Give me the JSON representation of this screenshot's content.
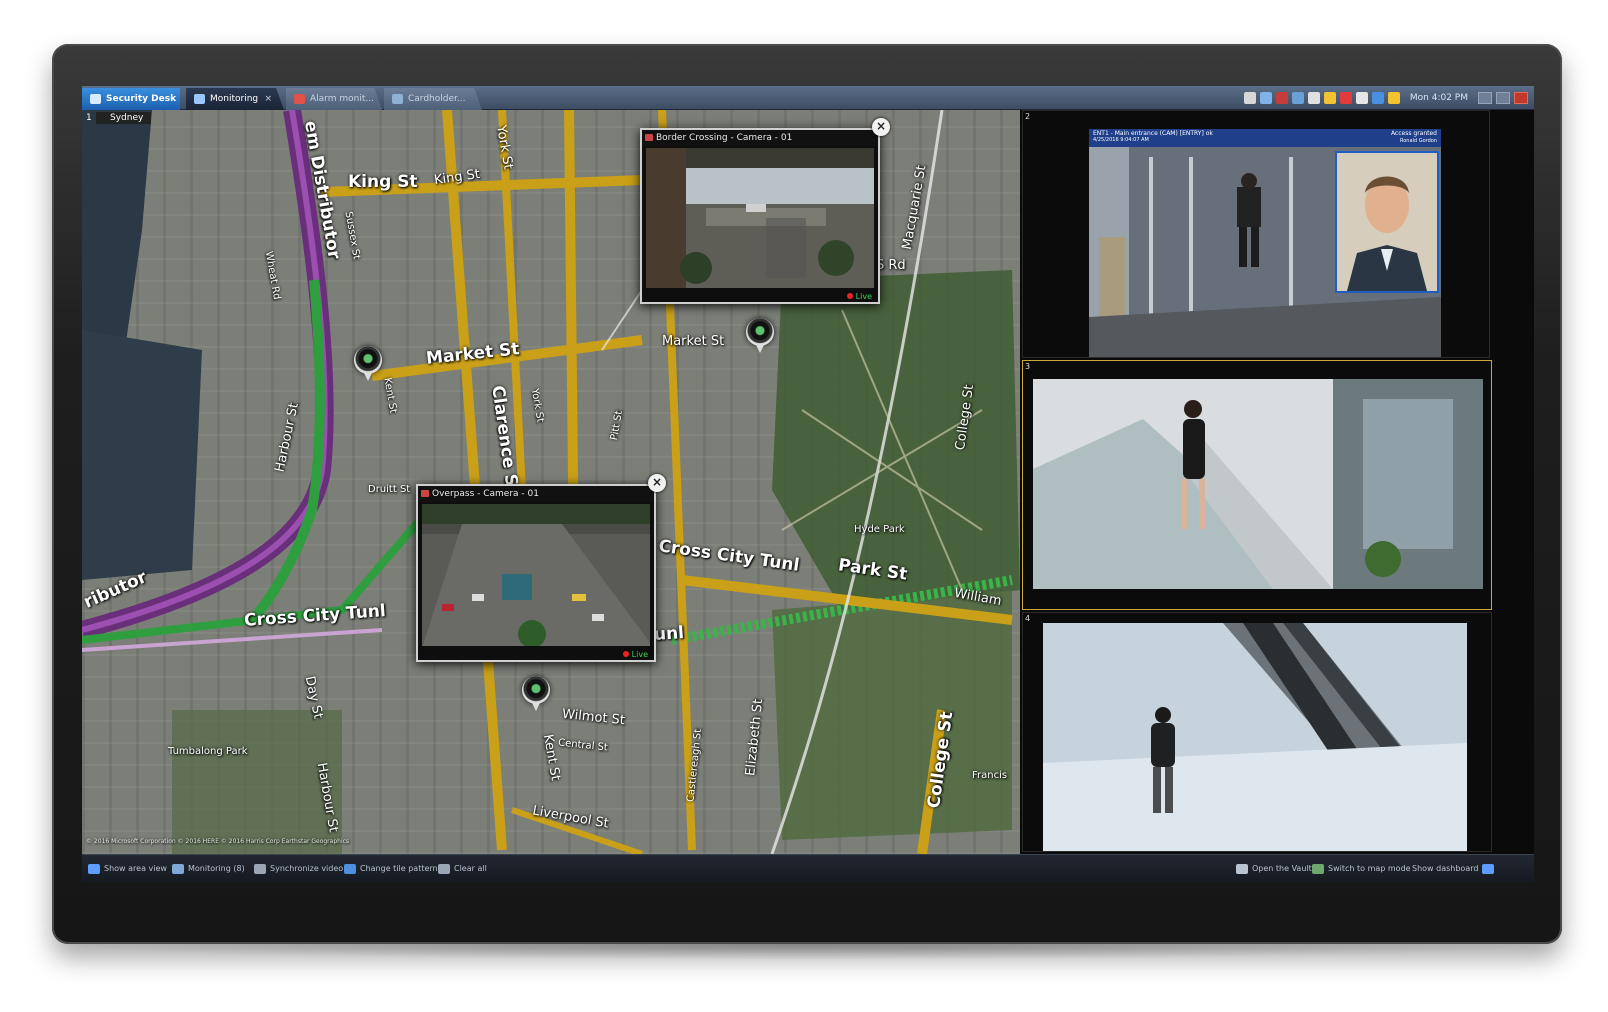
{
  "tabs": [
    {
      "label": "Security Desk",
      "icon": "security-desk-icon"
    },
    {
      "label": "Monitoring",
      "icon": "monitoring-icon",
      "close": "×"
    },
    {
      "label": "Alarm monit...",
      "icon": "alarm-icon"
    },
    {
      "label": "Cardholder...",
      "icon": "cardholder-icon"
    }
  ],
  "tray": {
    "clock": "Mon 4:02 PM",
    "icon_colors": [
      "#d7d7d7",
      "#7fb2e6",
      "#c43c3c",
      "#6aa0d8",
      "#e0e0e0",
      "#f2c230",
      "#e23b3b",
      "#e6e6e6",
      "#4a8fe0",
      "#f2c230"
    ]
  },
  "map": {
    "tile_number": "1",
    "city": "Sydney",
    "streets_big": [
      "King St",
      "King St",
      "Market St",
      "Market St",
      "Cross City Tunl",
      "Park St",
      "Cross City Tunl",
      "York St",
      "Clarence St",
      "em Distributor",
      "ributor",
      "Harbour St",
      "Macquarie St",
      "College St",
      "College St",
      "Elizabeth St",
      "Kent St",
      "Day St",
      "Harbour St",
      "Liverpool St",
      "William",
      "S Rd",
      "unl"
    ],
    "streets_small": [
      "Hyde Park",
      "Wilmot St",
      "Central St",
      "Druitt St",
      "Castlereagh St",
      "Tumbalong Park",
      "Francis",
      "Sussex St",
      "Wheat Rd",
      "Pitt St",
      "Kent St",
      "York St"
    ],
    "copyright": "© 2016 Microsoft Corporation  © 2016 HERE  © 2016 Harris Corp Earthstar Geographics"
  },
  "popups": [
    {
      "title": "Border Crossing - Camera - 01",
      "live": "Live",
      "close": "×"
    },
    {
      "title": "Overpass - Camera - 01",
      "live": "Live",
      "close": "×"
    }
  ],
  "tiles": [
    {
      "number": "2",
      "header": "ENT1 - Main entrance (CAM) [ENTRY] ok",
      "status": "Access granted",
      "subheader": "4/25/2016 9:04:07 AM",
      "name": "Ronald Gordon"
    },
    {
      "number": "3"
    },
    {
      "number": "4"
    }
  ],
  "toolbar": {
    "left": [
      {
        "label": "Show area view",
        "icon": "chevron-right-icon",
        "color": "#5f9cff"
      },
      {
        "label": "Monitoring (8)",
        "icon": "monitoring-icon",
        "color": "#7fa7d6"
      },
      {
        "label": "Synchronize video",
        "icon": "sync-icon",
        "color": "#9aa6b5"
      },
      {
        "label": "Change tile pattern",
        "icon": "tile-pattern-icon",
        "color": "#4f8fe0"
      },
      {
        "label": "Clear all",
        "icon": "clear-icon",
        "color": "#9aa6b5"
      }
    ],
    "right": [
      {
        "label": "Open the Vault",
        "icon": "vault-icon",
        "color": "#b9c4d2"
      },
      {
        "label": "Switch to map mode",
        "icon": "map-icon",
        "color": "#6ea86f"
      },
      {
        "label": "Show dashboard",
        "icon": "chevron-left-icon",
        "color": "#5f9cff"
      }
    ]
  }
}
